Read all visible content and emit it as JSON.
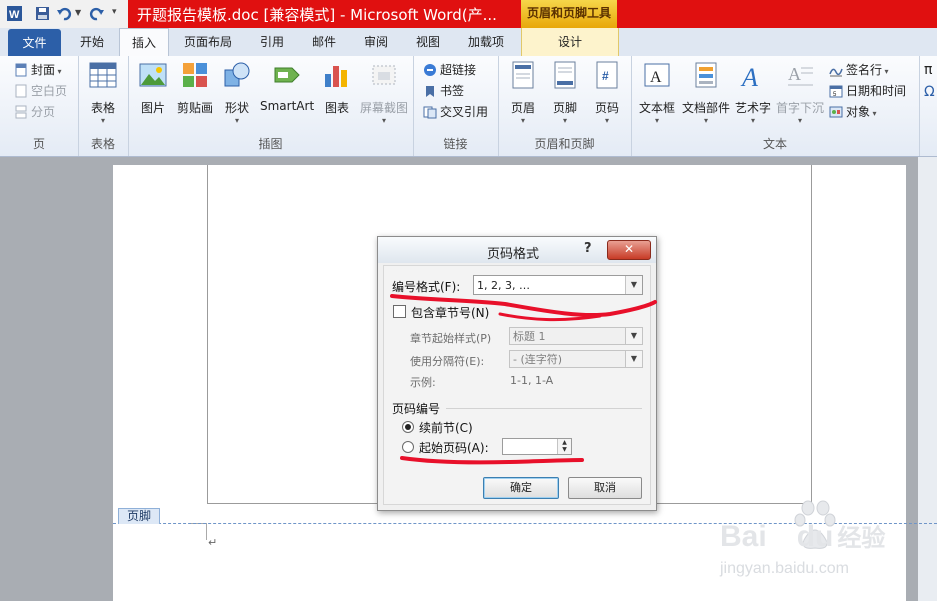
{
  "window": {
    "title": "开题报告模板.doc [兼容模式] - Microsoft Word(产...",
    "tool_tab": "页眉和页脚工具"
  },
  "tabs": {
    "file": "文件",
    "home": "开始",
    "insert": "插入",
    "layout": "页面布局",
    "references": "引用",
    "mailings": "邮件",
    "review": "审阅",
    "view": "视图",
    "addins": "加载项",
    "design": "设计"
  },
  "ribbon": {
    "page_group": {
      "label": "页",
      "cover": "封面",
      "blank_page": "空白页",
      "page_break": "分页"
    },
    "table_group": {
      "label": "表格",
      "table": "表格"
    },
    "illustrations_group": {
      "label": "插图",
      "picture": "图片",
      "clipart": "剪贴画",
      "shapes": "形状",
      "smartart": "SmartArt",
      "chart": "图表",
      "screenshot": "屏幕截图"
    },
    "links_group": {
      "label": "链接",
      "hyperlink": "超链接",
      "bookmark": "书签",
      "crossref": "交叉引用"
    },
    "header_footer_group": {
      "label": "页眉和页脚",
      "header": "页眉",
      "footer": "页脚",
      "page_number": "页码"
    },
    "text_group": {
      "label": "文本",
      "textbox": "文本框",
      "quickparts": "文档部件",
      "wordart": "艺术字",
      "dropcap": "首字下沉",
      "signature": "签名行",
      "datetime": "日期和时间",
      "object": "对象"
    },
    "extra": {
      "symbol_partial": "π",
      "omega_partial": "Ω"
    }
  },
  "document": {
    "footer_tag": "页脚",
    "paragraph_mark": "↵"
  },
  "dialog": {
    "title": "页码格式",
    "help": "?",
    "close": "✕",
    "number_format_label": "编号格式(F):",
    "number_format_value": "1, 2, 3, …",
    "include_chapter_label": "包含章节号(N)",
    "chapter_style_label": "章节起始样式(P)",
    "chapter_style_value": "标题 1",
    "separator_label": "使用分隔符(E):",
    "separator_value": "-  (连字符)",
    "example_label": "示例:",
    "example_value": "1-1, 1-A",
    "numbering_section": "页码编号",
    "continue_label": "续前节(C)",
    "start_at_label": "起始页码(A):",
    "ok": "确定",
    "cancel": "取消"
  },
  "watermark": {
    "brand": "Bai",
    "brand2": "du",
    "cn": "经验",
    "url": "jingyan.baidu.com"
  },
  "colors": {
    "title_bar": "#e01010",
    "file_tab": "#2c5fa8",
    "annotation": "#e8102a"
  }
}
